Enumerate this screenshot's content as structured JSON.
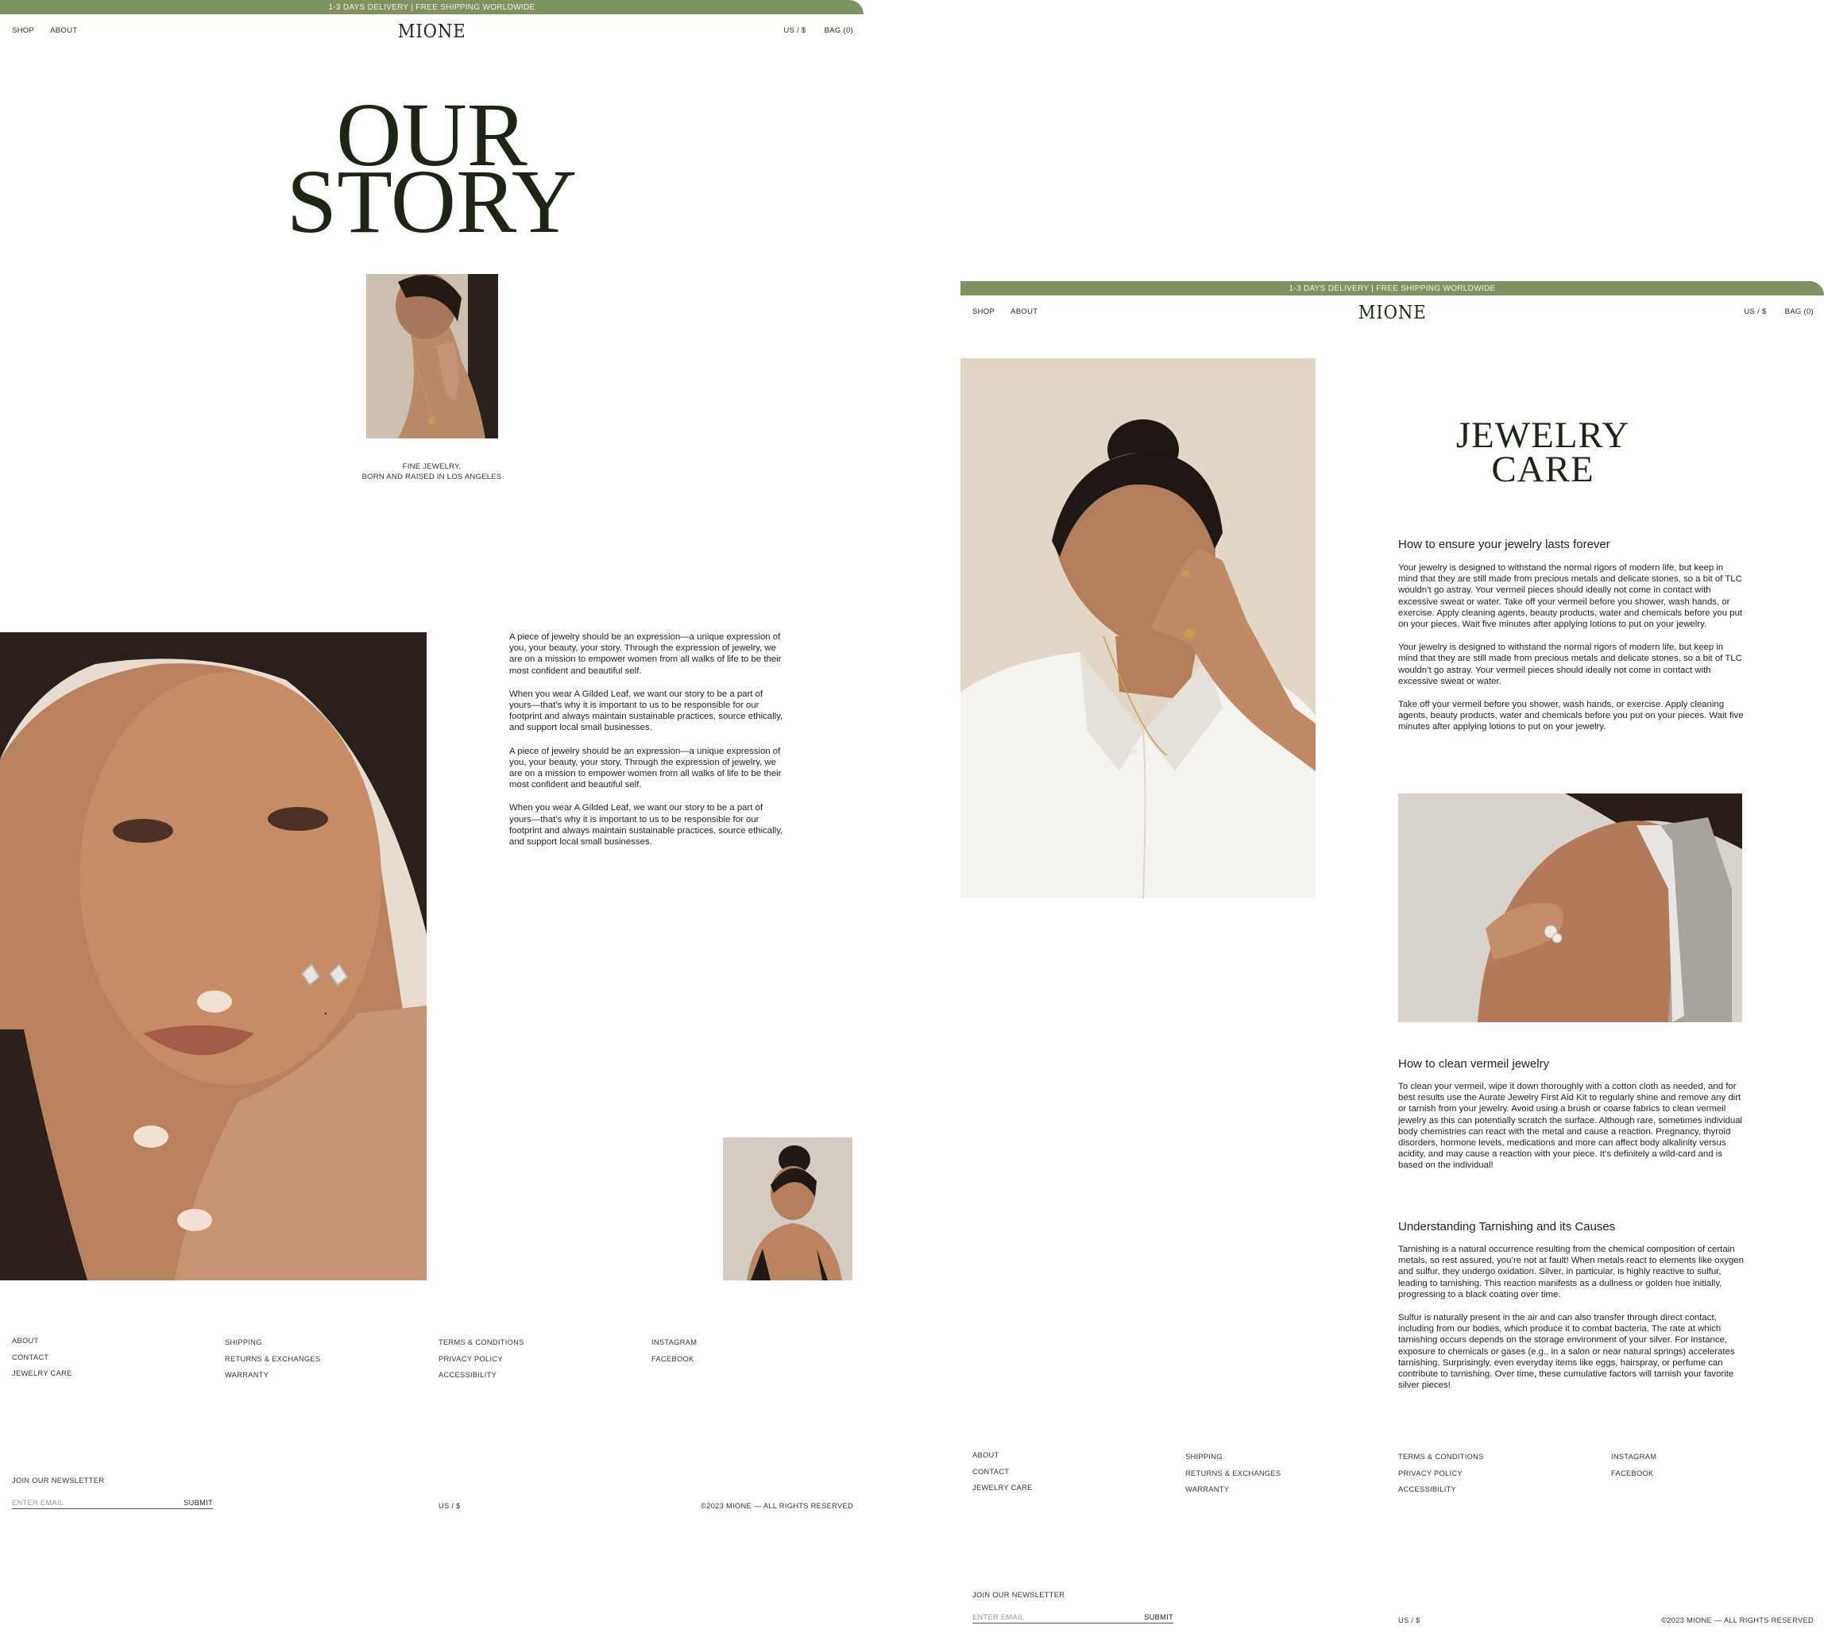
{
  "banner": {
    "text": "1-3 DAYS DELIVERY | FREE SHIPPING WORLDWIDE"
  },
  "nav": {
    "shop": "SHOP",
    "about": "ABOUT",
    "currency": "US / $",
    "bag": "BAG (0)"
  },
  "logo": {
    "text": "MIONE"
  },
  "story": {
    "title_line1": "OUR",
    "title_line2": "STORY",
    "caption_line1": "FINE JEWELRY,",
    "caption_line2": "BORN AND RAISED IN LOS ANGELES",
    "paragraphs": [
      "A piece of jewelry should be an expression—a unique expression of you, your beauty, your story. Through the expression of jewelry, we are on a mission to empower women from all walks of life to be their most confident and beautiful self.",
      "When you wear A Gilded Leaf, we want our story to be a part of yours—that’s why it is important to us to be responsible for our footprint and always maintain sustainable practices, source ethically, and support local small businesses.",
      "A piece of jewelry should be an expression—a unique expression of you, your beauty, your story. Through the expression of jewelry, we are on a mission to empower women from all walks of life to be their most confident and beautiful self.",
      "When you wear A Gilded Leaf, we want our story to be a part of yours—that’s why it is important to us to be responsible for our footprint and always maintain sustainable practices, source ethically, and support local small businesses."
    ]
  },
  "care": {
    "title_line1": "JEWELRY",
    "title_line2": "CARE",
    "section1_heading": "How to ensure your jewelry lasts forever",
    "section1_paragraphs": [
      "Your jewelry is designed to withstand the normal rigors of modern life, but keep in mind that they are still made from precious metals and delicate stones, so a bit of TLC wouldn’t go astray. Your vermeil pieces should ideally not come in contact with excessive sweat or water.  Take off your vermeil before you shower, wash hands, or exercise. Apply cleaning agents, beauty products, water and chemicals before you put on your pieces. Wait five minutes after applying lotions to put on your jewelry.",
      "Your jewelry is designed to withstand the normal rigors of modern life, but keep in mind that they are still made from precious metals and delicate stones, so a bit of TLC wouldn’t go astray. Your vermeil pieces should ideally not come in contact with excessive sweat or water.",
      "Take off your vermeil before you shower, wash hands, or exercise. Apply cleaning agents, beauty products, water and chemicals before you put on your pieces. Wait five minutes after applying lotions to put on your jewelry."
    ],
    "section2_heading": "How to clean vermeil jewelry",
    "section2_paragraphs": [
      "To clean your vermeil, wipe it down thoroughly with a cotton cloth as needed, and for best results use the Aurate Jewelry First Aid Kit to regularly shine and remove any dirt or tarnish from your jewelry. Avoid using a brush or coarse fabrics to clean vermeil jewelry as this can potentially scratch the surface. Although rare, sometimes individual body chemistries can react with the metal and cause a reaction. Pregnancy, thyroid disorders, hormone levels, medications and more can affect body alkalinity versus acidity, and may cause a reaction with your piece. It’s definitely a wild-card and is based on the individual!"
    ],
    "section3_heading": "Understanding Tarnishing and its Causes",
    "section3_paragraphs": [
      "Tarnishing is a natural occurrence resulting from the chemical composition of certain metals, so rest assured, you’re not at fault! When metals react to elements like oxygen and sulfur, they undergo oxidation. Silver, in particular, is highly reactive to sulfur, leading to tarnishing. This reaction manifests as a dullness or golden hue initially, progressing to a black coating over time.",
      "Sulfur is naturally present in the air and can also transfer through direct contact, including from our bodies, which produce it to combat bacteria. The rate at which tarnishing occurs depends on the storage environment of your silver. For instance, exposure to chemicals or gases (e.g., in a salon or near natural springs) accelerates tarnishing. Surprisingly, even everyday items like eggs, hairspray, or perfume can contribute to tarnishing. Over time, these cumulative factors will tarnish your favorite silver pieces!"
    ]
  },
  "footer": {
    "col1": [
      "ABOUT",
      "CONTACT",
      "JEWELRY CARE"
    ],
    "col2": [
      "SHIPPING",
      "RETURNS & EXCHANGES",
      "WARRANTY"
    ],
    "col3": [
      "TERMS & CONDITIONS",
      "PRIVACY POLICY",
      "ACCESSIBILITY"
    ],
    "col4": [
      "INSTAGRAM",
      "FACEBOOK"
    ],
    "newsletter_label": "JOIN OUR NEWSLETTER",
    "email_placeholder": "ENTER EMAIL",
    "submit": "SUBMIT",
    "currency": "US / $",
    "copyright": "©2023 MIONE — ALL RIGHTS RESERVED"
  },
  "colors": {
    "banner": "#7e935f",
    "text": "#1d2616",
    "background": "#ffffff"
  }
}
